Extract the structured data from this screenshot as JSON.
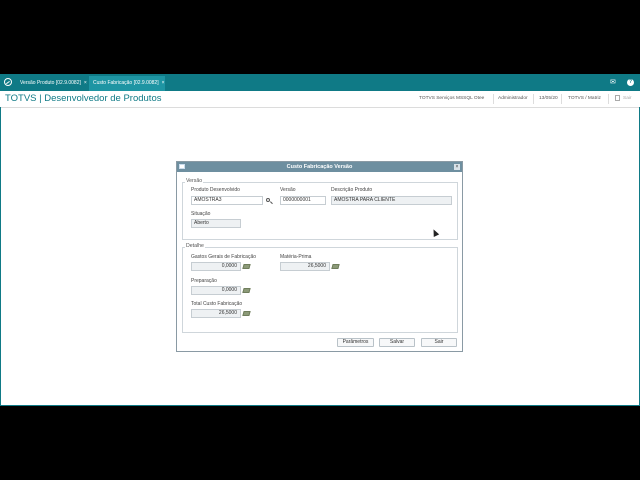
{
  "tabs": [
    {
      "label": "Versão Produto [02.9.0082]"
    },
    {
      "label": "Custo Fabricação [02.9.0082]"
    }
  ],
  "tab_close": "×",
  "header": {
    "title": "TOTVS | Desenvolvedor de Produtos",
    "company": "TOTVS Serviços MSSQL Otee",
    "user": "Administrador",
    "date": "13/05/20",
    "branch": "TOTVS / Matriz",
    "exit": "Sair"
  },
  "icons": {
    "mail": "mail-icon",
    "help": "help-icon",
    "close": "close-icon"
  },
  "dialog": {
    "title": "Custo Fabricação Versão",
    "close": "×",
    "version_group": {
      "legend": "Versão",
      "produto_label": "Produto Desenvolvido",
      "produto_value": "AMOSTRA3",
      "versao_label": "Versão",
      "versao_value": "0000000001",
      "descricao_label": "Descrição Produto",
      "descricao_value": "AMOSTRA PARA CLIENTE",
      "situacao_label": "Situação",
      "situacao_value": "Aberto"
    },
    "detail_group": {
      "legend": "Detalhe",
      "gastos_label": "Gastos Gerais de Fabricação",
      "gastos_value": "0,0000",
      "materia_label": "Matéria-Prima",
      "materia_value": "26,5000",
      "preparacao_label": "Preparação",
      "preparacao_value": "0,0000",
      "total_label": "Total Custo Fabricação",
      "total_value": "26,5000"
    },
    "buttons": {
      "parametros": "Parâmetros",
      "salvar": "Salvar",
      "sair": "Sair"
    }
  }
}
